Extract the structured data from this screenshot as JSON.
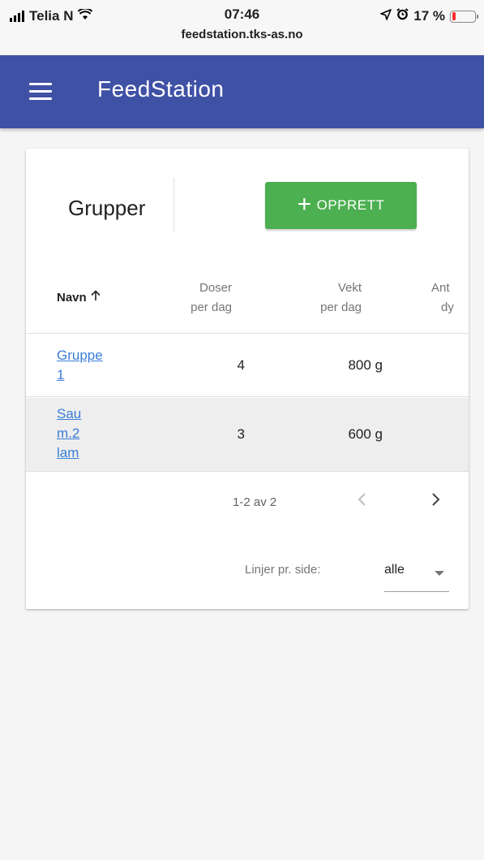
{
  "status_bar": {
    "carrier": "Telia N",
    "time": "07:46",
    "url": "feedstation.tks-as.no",
    "battery": "17 %",
    "battery_level": 0.17
  },
  "appbar": {
    "title": "FeedStation"
  },
  "card": {
    "title": "Grupper",
    "create_label": "OPPRETT"
  },
  "table": {
    "headers": {
      "name": "Navn",
      "doser_line1": "Doser",
      "doser_line2": "per dag",
      "vekt_line1": "Vekt",
      "vekt_line2": "per dag",
      "antall_line1": "Ant",
      "antall_line2": "dy"
    },
    "rows": [
      {
        "name_line1": "Gruppe",
        "name_line2": "1",
        "name_line3": "",
        "doser": "4",
        "vekt": "800 g"
      },
      {
        "name_line1": "Sau",
        "name_line2": "m.2",
        "name_line3": "lam",
        "doser": "3",
        "vekt": "600 g"
      }
    ]
  },
  "pagination": {
    "range": "1-2 av 2",
    "rows_per_page_label": "Linjer pr. side:",
    "rows_per_page_value": "alle"
  },
  "colors": {
    "appbar": "#3f51a5",
    "create_button": "#4caf50",
    "link": "#3b7dd8",
    "selected_row": "#eeeeee"
  }
}
